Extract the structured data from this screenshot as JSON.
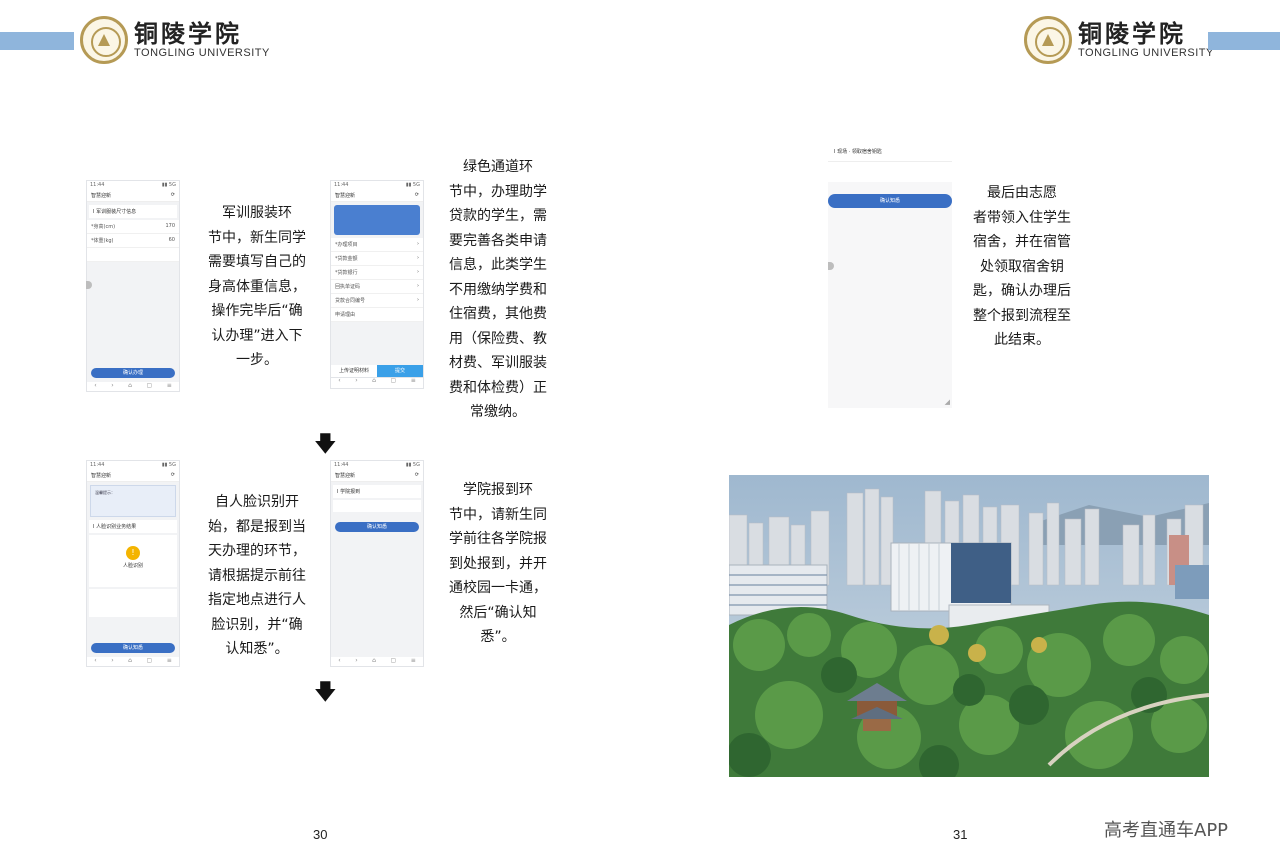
{
  "header": {
    "logo_cn": "铜陵学院",
    "logo_en": "TONGLING UNIVERSITY"
  },
  "left_page": {
    "page_number": "30",
    "step_uniform": {
      "phone": {
        "title": "智慧迎新",
        "card_title": "Ⅰ 军训服装尺寸信息",
        "height_label": "*身高(cm)",
        "height_value": "170",
        "weight_label": "*体重(kg)",
        "weight_value": "60",
        "button": "确认办理"
      },
      "caption_lines": [
        "军训服装环",
        "节中，新生同学",
        "需要填写自己的",
        "身高体重信息，",
        "操作完毕后“确",
        "认办理”进入下",
        "一步。"
      ]
    },
    "step_green": {
      "phone": {
        "title": "智慧迎新",
        "rows": [
          "*办理项目",
          "*贷款金额",
          "*贷款银行",
          "回执单证码",
          "贷款合同编号",
          "申请理由"
        ],
        "left_button": "上传证明材料",
        "right_button": "提交"
      },
      "caption_lines": [
        "绿色通道环",
        "节中，办理助学",
        "贷款的学生，需",
        "要完善各类申请",
        "信息，此类学生",
        "不用缴纳学费和",
        "住宿费，其他费",
        "用（保险费、教",
        "材费、军训服装",
        "费和体检费）正",
        "常缴纳。"
      ]
    },
    "step_face": {
      "phone": {
        "title": "智慧迎新",
        "notice_title": "温馨提示：",
        "card_title": "Ⅰ 人脸识别业务结果",
        "face_label": "人脸识别",
        "button": "确认知悉"
      },
      "caption_lines": [
        "自人脸识别开",
        "始，都是报到当",
        "天办理的环节，",
        "请根据提示前往",
        "指定地点进行人",
        "脸识别，并“确",
        "认知悉”。"
      ]
    },
    "step_college": {
      "phone": {
        "title": "智慧迎新",
        "card_title": "Ⅰ 学院报到",
        "button": "确认知悉"
      },
      "caption_lines": [
        "学院报到环",
        "节中，请新生同",
        "学前往各学院报",
        "到处报到，并开",
        "通校园一卡通，",
        "然后“确认知",
        "悉”。"
      ]
    }
  },
  "right_page": {
    "page_number": "31",
    "step_dorm": {
      "phone": {
        "card_title": "Ⅰ 现场 · 领取宿舍钥匙",
        "button": "确认知悉"
      },
      "caption_lines": [
        "最后由志愿",
        "者带领入住学生",
        "宿舍，并在宿管",
        "处领取宿舍钥",
        "匙，确认办理后",
        "整个报到流程至",
        "此结束。"
      ]
    }
  },
  "watermark": "高考直通车APP"
}
